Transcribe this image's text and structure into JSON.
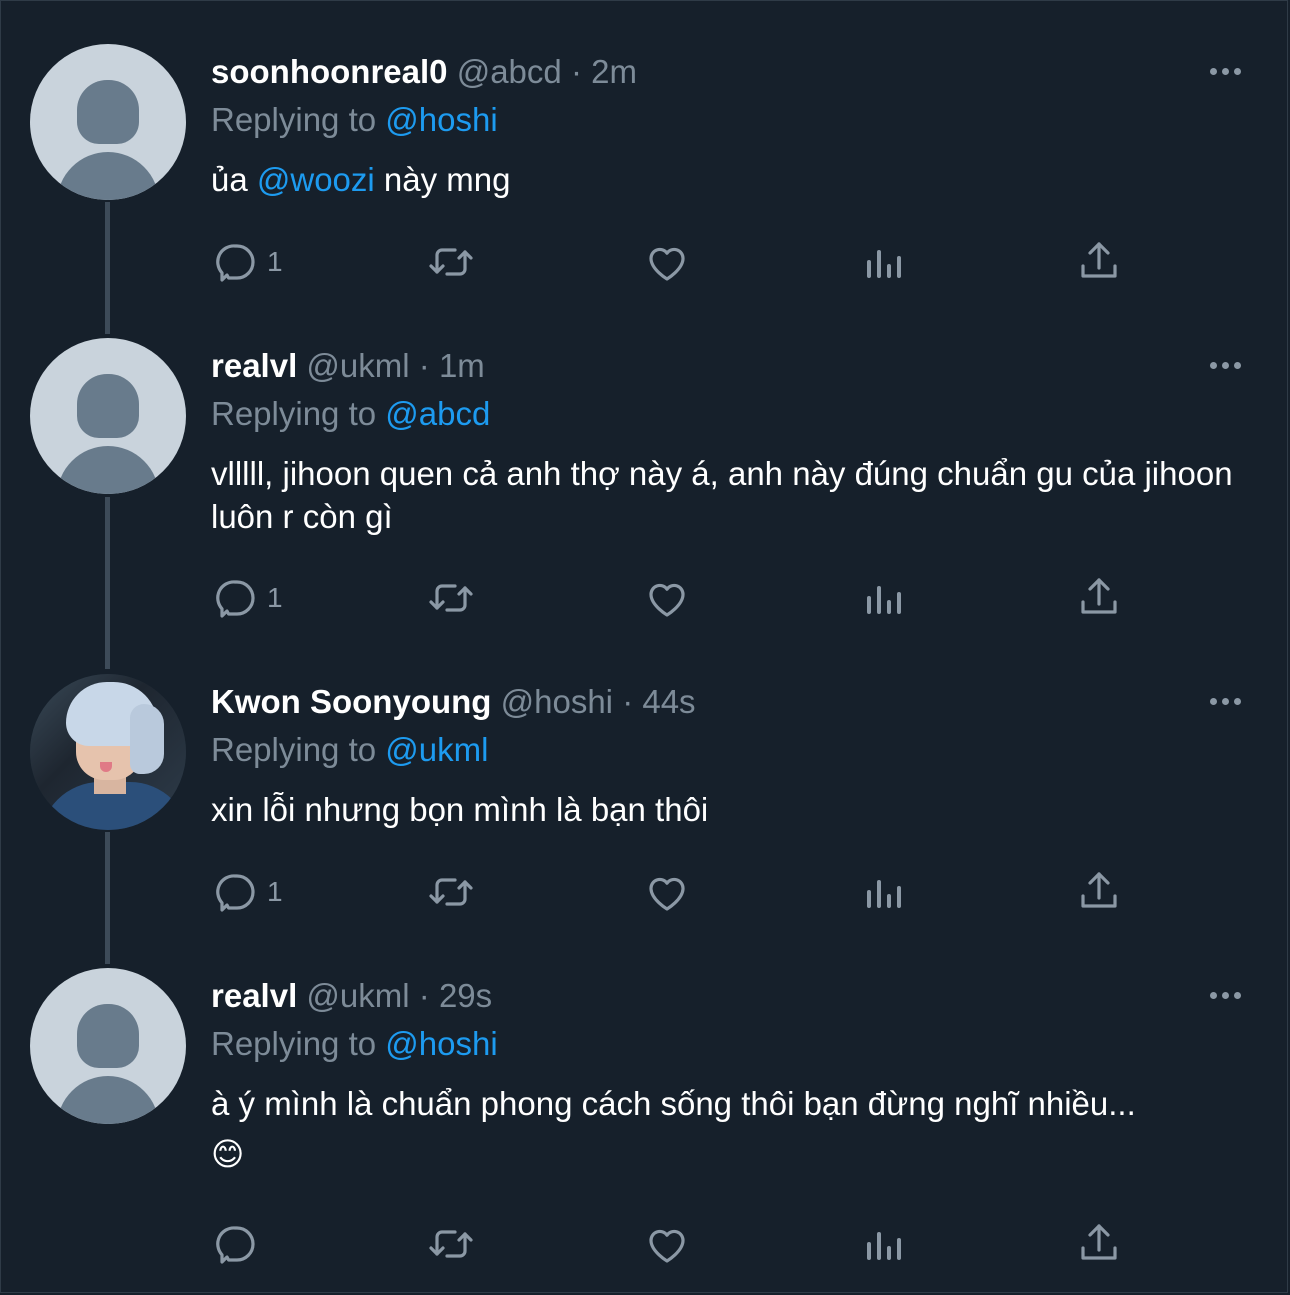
{
  "colors": {
    "background": "#16202b",
    "mention": "#1d9bf0",
    "muted": "#7d8b98",
    "icon": "#8b98a5"
  },
  "tweets": [
    {
      "name": "soonhoonreal0",
      "handle": "@abcd",
      "time": "· 2m",
      "replying_prefix": "Replying to ",
      "replying_to": "@hoshi",
      "text_before": "ủa ",
      "text_mention": "@woozi",
      "text_after": " này mng",
      "reply_count": "1",
      "avatar": "default-avatar-icon"
    },
    {
      "name": "realvl",
      "handle": "@ukml",
      "time": "· 1m",
      "replying_prefix": "Replying to ",
      "replying_to": "@abcd",
      "text": "vlllll, jihoon quen cả anh thợ này á, anh này đúng chuẩn gu của jihoon luôn r còn gì",
      "reply_count": "1",
      "avatar": "default-avatar-icon"
    },
    {
      "name": "Kwon Soonyoung",
      "handle": "@hoshi",
      "time": "· 44s",
      "replying_prefix": "Replying to ",
      "replying_to": "@ukml",
      "text": "xin lỗi nhưng bọn mình là bạn thôi",
      "reply_count": "1",
      "avatar": "profile-photo"
    },
    {
      "name": "realvl",
      "handle": "@ukml",
      "time": "· 29s",
      "replying_prefix": "Replying to ",
      "replying_to": "@hoshi",
      "text": "à ý mình là chuẩn phong cách sống thôi bạn đừng nghĩ nhiều...",
      "emoji": "😊",
      "reply_count": "",
      "avatar": "default-avatar-icon"
    }
  ],
  "action_icons": [
    "reply-icon",
    "retweet-icon",
    "like-icon",
    "analytics-icon",
    "share-icon"
  ]
}
